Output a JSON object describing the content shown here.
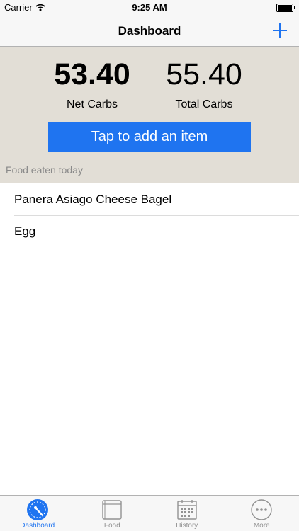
{
  "status_bar": {
    "carrier": "Carrier",
    "time": "9:25 AM",
    "battery_level": 1.0
  },
  "nav": {
    "title": "Dashboard",
    "add_icon": "plus-icon"
  },
  "summary": {
    "net_carbs": {
      "value": "53.40",
      "label": "Net Carbs"
    },
    "total_carbs": {
      "value": "55.40",
      "label": "Total Carbs"
    },
    "add_button_label": "Tap to add an item",
    "section_header": "Food eaten today"
  },
  "food_items": [
    {
      "name": "Panera Asiago Cheese Bagel"
    },
    {
      "name": "Egg"
    }
  ],
  "tabs": [
    {
      "label": "Dashboard",
      "icon": "gauge-icon",
      "active": true
    },
    {
      "label": "Food",
      "icon": "book-icon",
      "active": false
    },
    {
      "label": "History",
      "icon": "calendar-icon",
      "active": false
    },
    {
      "label": "More",
      "icon": "more-icon",
      "active": false
    }
  ],
  "colors": {
    "accent": "#1f74f0",
    "summary_bg": "#e2ded6",
    "inactive_tab": "#929292"
  }
}
